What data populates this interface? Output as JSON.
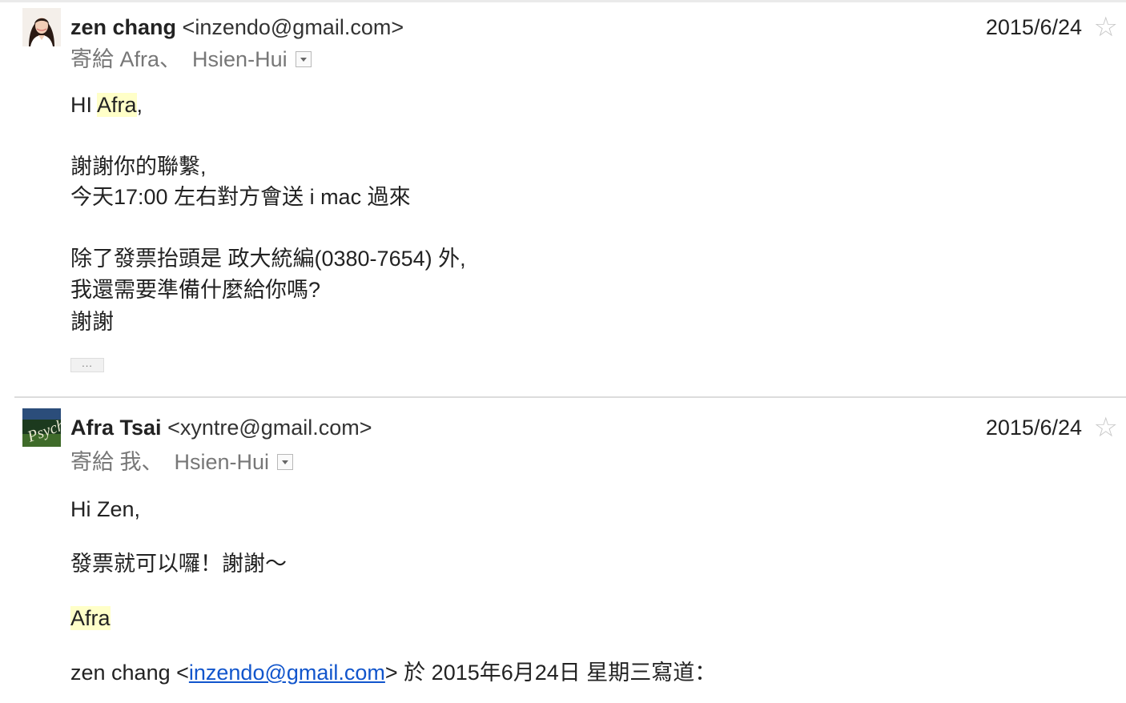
{
  "messages": [
    {
      "sender_name": "zen chang",
      "sender_email": "<inzendo@gmail.com>",
      "date": "2015/6/24",
      "to_prefix": "寄給",
      "recipient_1": "Afra",
      "separator": "、",
      "recipient_2": "Hsien-Hui",
      "greeting_prefix": "HI ",
      "greeting_name": "Afra",
      "greeting_suffix": ",",
      "lines": [
        "謝謝你的聯繫,",
        "今天17:00 左右對方會送 i mac 過來",
        "除了發票抬頭是 政大統編(0380-7654) 外,",
        "我還需要準備什麼給你嗎?",
        "謝謝"
      ],
      "show_trimmed": "..."
    },
    {
      "sender_name": "Afra Tsai",
      "sender_email": "<xyntre@gmail.com>",
      "date": "2015/6/24",
      "to_prefix": "寄給",
      "recipient_1": "我",
      "separator": "、",
      "recipient_2": "Hsien-Hui",
      "greeting": "Hi Zen,",
      "line_1": "發票就可以囉！謝謝～",
      "signature": "Afra",
      "quote_prefix": "zen chang <",
      "quote_link": "inzendo@gmail.com",
      "quote_suffix": "> 於 2015年6月24日 星期三寫道："
    }
  ],
  "icons": {
    "star": "star-outline-icon",
    "dropdown": "chevron-down-icon"
  },
  "colors": {
    "highlight": "#ffffc8",
    "link": "#1155cc",
    "muted": "#777777"
  }
}
